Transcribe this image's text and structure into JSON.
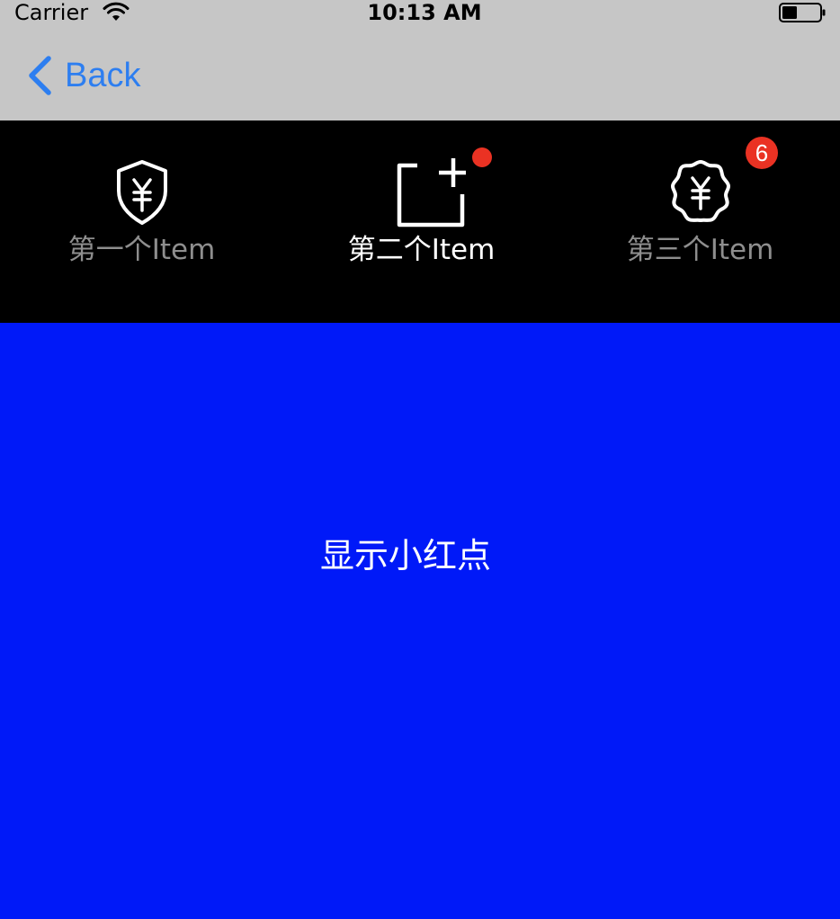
{
  "status_bar": {
    "carrier": "Carrier",
    "time": "10:13 AM",
    "wifi_icon": "wifi-icon",
    "battery_icon": "battery-icon"
  },
  "nav_bar": {
    "back_label": "Back",
    "back_icon": "chevron-left-icon",
    "tint_color": "#2d7ef0",
    "background": "#c6c6c6"
  },
  "tab_bar": {
    "background": "#000000",
    "selected_color": "#ffffff",
    "unselected_color": "#8e8e8e",
    "items": [
      {
        "label": "第一个Item",
        "icon": "shield-yen-icon",
        "selected": false
      },
      {
        "label": "第二个Item",
        "icon": "add-square-icon",
        "selected": true,
        "red_dot": true
      },
      {
        "label": "第三个Item",
        "icon": "yen-badge-icon",
        "selected": false,
        "badge": "6"
      }
    ],
    "badge_color": "#ea3223"
  },
  "content": {
    "background": "#0019f8",
    "label": "显示小红点"
  }
}
